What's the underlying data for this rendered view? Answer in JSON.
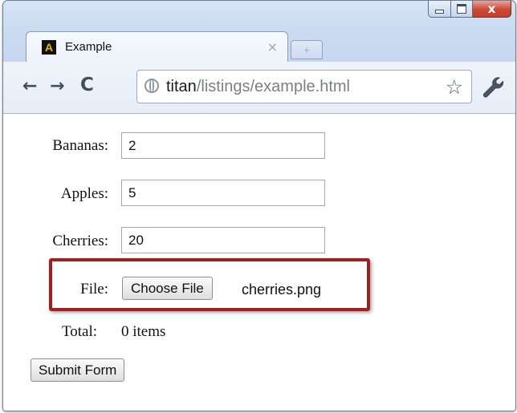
{
  "browser": {
    "tab_title": "Example",
    "tab_close": "×",
    "new_tab": "+",
    "url_host": "titan",
    "url_path": "/listings/example.html",
    "back_icon": "←",
    "forward_icon": "→",
    "reload_icon": "C",
    "star_icon": "☆",
    "close_glyph": "x",
    "favicon_letter": "A"
  },
  "form": {
    "fields": [
      {
        "label": "Bananas:",
        "value": "2"
      },
      {
        "label": "Apples:",
        "value": "5"
      },
      {
        "label": "Cherries:",
        "value": "20"
      }
    ],
    "file_label": "File:",
    "file_button": "Choose File",
    "file_name": "cherries.png",
    "total_label": "Total:",
    "total_value": "0 items",
    "submit_label": "Submit Form"
  },
  "colors": {
    "highlight": "#a11f1e",
    "close_button": "#c94a34",
    "frame": "#c9dbf1"
  }
}
